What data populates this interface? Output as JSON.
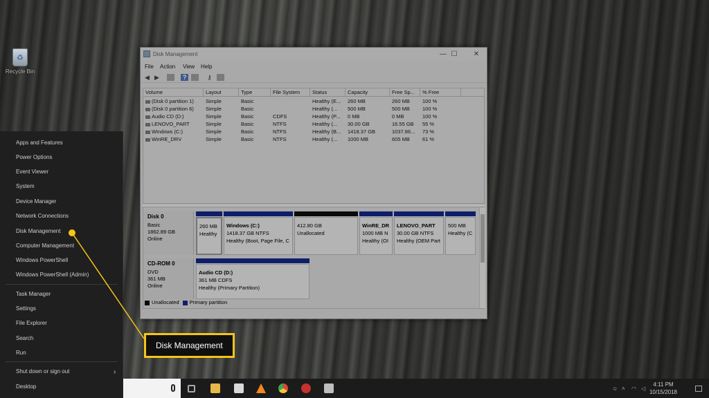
{
  "desktop": {
    "recycle_bin_label": "Recycle Bin"
  },
  "winx_menu": {
    "items": [
      {
        "label": "Apps and Features"
      },
      {
        "label": "Power Options"
      },
      {
        "label": "Event Viewer"
      },
      {
        "label": "System"
      },
      {
        "label": "Device Manager"
      },
      {
        "label": "Network Connections"
      },
      {
        "label": "Disk Management"
      },
      {
        "label": "Computer Management"
      },
      {
        "label": "Windows PowerShell"
      },
      {
        "label": "Windows PowerShell (Admin)"
      },
      {
        "label": "Task Manager"
      },
      {
        "label": "Settings"
      },
      {
        "label": "File Explorer"
      },
      {
        "label": "Search"
      },
      {
        "label": "Run"
      },
      {
        "label": "Shut down or sign out"
      },
      {
        "label": "Desktop"
      }
    ],
    "shutdown_chevron": "›"
  },
  "window": {
    "title": "Disk Management",
    "minimize": "—",
    "maximize": "☐",
    "close": "✕",
    "menu": [
      "File",
      "Action",
      "View",
      "Help"
    ],
    "toolbar_icons": [
      "back-arrow-icon",
      "forward-arrow-icon",
      "list-view-icon",
      "help-icon",
      "properties-icon",
      "key-icon",
      "console-icon"
    ]
  },
  "volume_list": {
    "columns": [
      "Volume",
      "Layout",
      "Type",
      "File System",
      "Status",
      "Capacity",
      "Free Sp...",
      "% Free"
    ],
    "rows": [
      [
        "(Disk 0 partition 1)",
        "Simple",
        "Basic",
        "",
        "Healthy (E...",
        "260 MB",
        "260 MB",
        "100 %"
      ],
      [
        "(Disk 0 partition 6)",
        "Simple",
        "Basic",
        "",
        "Healthy (...",
        "500 MB",
        "500 MB",
        "100 %"
      ],
      [
        "Audio CD (D:)",
        "Simple",
        "Basic",
        "CDFS",
        "Healthy (P...",
        "0 MB",
        "0 MB",
        "100 %"
      ],
      [
        "LENOVO_PART",
        "Simple",
        "Basic",
        "NTFS",
        "Healthy (...",
        "30.00 GB",
        "16.55 GB",
        "55 %"
      ],
      [
        "Windows (C:)",
        "Simple",
        "Basic",
        "NTFS",
        "Healthy (B...",
        "1418.37 GB",
        "1037.86...",
        "73 %"
      ],
      [
        "WinRE_DRV",
        "Simple",
        "Basic",
        "NTFS",
        "Healthy (...",
        "1000 MB",
        "605 MB",
        "61 %"
      ]
    ]
  },
  "graph": {
    "disk0": {
      "name": "Disk 0",
      "type": "Basic",
      "size": "1862.89 GB",
      "state": "Online"
    },
    "disk0_partitions": [
      {
        "title": "",
        "size": "260 MB",
        "status": "Healthy",
        "kind": "primary"
      },
      {
        "title": "Windows  (C:)",
        "size": "1418.37 GB NTFS",
        "status": "Healthy (Boot, Page File, C",
        "kind": "primary"
      },
      {
        "title": "",
        "size": "412.80 GB",
        "status": "Unallocated",
        "kind": "unallocated"
      },
      {
        "title": "WinRE_DR",
        "size": "1000 MB N",
        "status": "Healthy (OI",
        "kind": "primary"
      },
      {
        "title": "LENOVO_PART",
        "size": "30.00 GB NTFS",
        "status": "Healthy (OEM Part",
        "kind": "primary"
      },
      {
        "title": "",
        "size": "500 MB",
        "status": "Healthy (C",
        "kind": "primary"
      }
    ],
    "cdrom": {
      "name": "CD-ROM 0",
      "type": "DVD",
      "size": "361 MB",
      "state": "Online"
    },
    "cdrom_partition": {
      "title": "Audio CD  (D:)",
      "size": "361 MB CDFS",
      "status": "Healthy (Primary Partition)"
    },
    "legend": [
      "Unallocated",
      "Primary partition"
    ],
    "colors": {
      "unallocated": "#0a0a0a",
      "primary": "#0f1e6b"
    }
  },
  "callout": {
    "label": "Disk Management",
    "accent": "#f5c518"
  },
  "taskbar": {
    "apps": [
      "task-view-icon",
      "file-explorer-icon",
      "store-icon",
      "vlc-icon",
      "chrome-icon",
      "app-icon",
      "app-icon-2"
    ],
    "time": "4:11 PM",
    "date": "10/15/2018"
  }
}
